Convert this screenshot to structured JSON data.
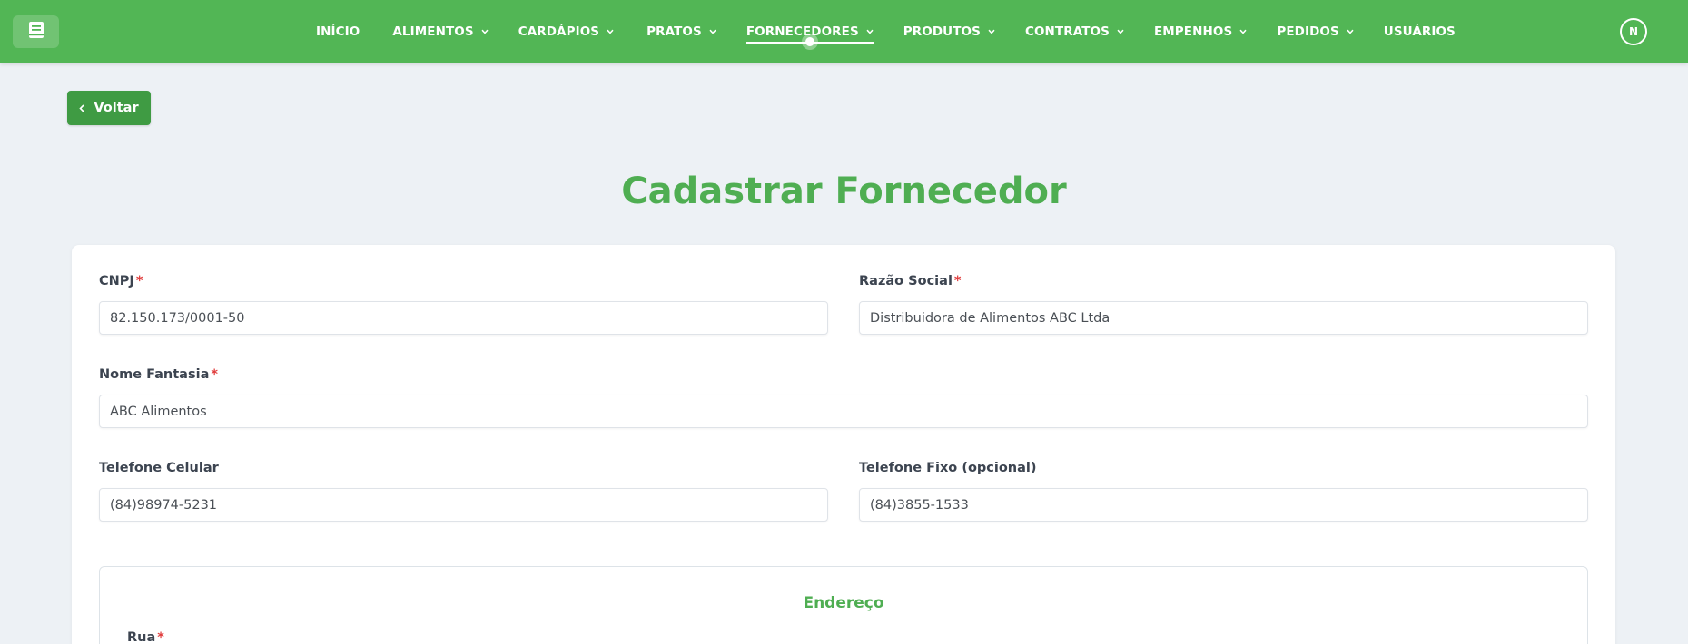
{
  "navbar": {
    "items": [
      {
        "label": "INÍCIO",
        "has_dropdown": false,
        "active": false
      },
      {
        "label": "ALIMENTOS",
        "has_dropdown": true,
        "active": false
      },
      {
        "label": "CARDÁPIOS",
        "has_dropdown": true,
        "active": false
      },
      {
        "label": "PRATOS",
        "has_dropdown": true,
        "active": false
      },
      {
        "label": "FORNECEDORES",
        "has_dropdown": true,
        "active": true
      },
      {
        "label": "PRODUTOS",
        "has_dropdown": true,
        "active": false
      },
      {
        "label": "CONTRATOS",
        "has_dropdown": true,
        "active": false
      },
      {
        "label": "EMPENHOS",
        "has_dropdown": true,
        "active": false
      },
      {
        "label": "PEDIDOS",
        "has_dropdown": true,
        "active": false
      },
      {
        "label": "USUÁRIOS",
        "has_dropdown": false,
        "active": false
      }
    ],
    "avatar_initial": "N",
    "logo_icon": "book-icon"
  },
  "back_button": {
    "label": "Voltar",
    "icon": "chevron-left-icon"
  },
  "page_title": "Cadastrar Fornecedor",
  "form": {
    "cnpj": {
      "label": "CNPJ",
      "required_mark": "*",
      "value": "82.150.173/0001-50"
    },
    "razao_social": {
      "label": "Razão Social",
      "required_mark": "*",
      "value": "Distribuidora de Alimentos ABC Ltda"
    },
    "nome_fantasia": {
      "label": "Nome Fantasia",
      "required_mark": "*",
      "value": "ABC Alimentos"
    },
    "telefone_celular": {
      "label": "Telefone Celular",
      "value": "(84)98974-5231"
    },
    "telefone_fixo": {
      "label": "Telefone Fixo (opcional)",
      "value": "(84)3855-1533"
    },
    "endereco": {
      "title": "Endereço",
      "rua": {
        "label": "Rua",
        "required_mark": "*"
      }
    }
  },
  "colors": {
    "primary_green": "#52b655",
    "button_green": "#3f9b43",
    "title_green": "#4fae52",
    "required_red": "#e03b3b",
    "background": "#edf1f5"
  }
}
